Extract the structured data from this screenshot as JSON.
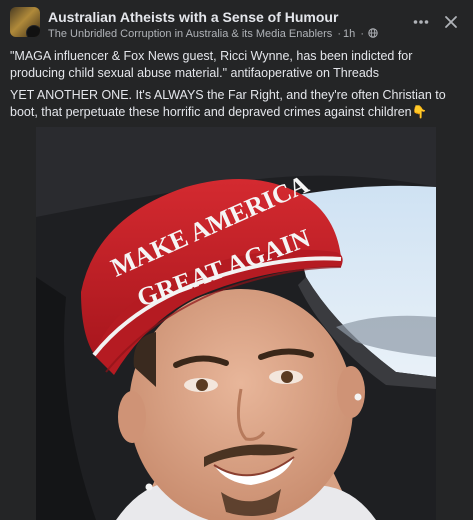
{
  "post": {
    "group_name": "Australian Atheists with a Sense of Humour",
    "author": "The Unbridled Corruption in Australia & its Media Enablers",
    "time": "1h",
    "separator": "·",
    "audience_icon": "globe-icon",
    "quote": "\"MAGA influencer & Fox News guest, Ricci Wynne, has been indicted for producing child sexual abuse material.\" antifaoperative on Threads",
    "body": "YET ANOTHER ONE. It's ALWAYS the Far Right, and they're often Christian to boot, that perpetuate these horrific and depraved crimes against children",
    "body_emoji": "👇"
  },
  "photo": {
    "hat_text_line1": "MAKE AMERICA",
    "hat_text_line2": "GREAT AGAIN"
  },
  "icons": {
    "more": "more-horizontal-icon",
    "close": "close-icon"
  },
  "colors": {
    "background": "#242526",
    "text_primary": "#e4e6eb",
    "text_secondary": "#b0b3b8",
    "hat_red": "#c8222b"
  }
}
